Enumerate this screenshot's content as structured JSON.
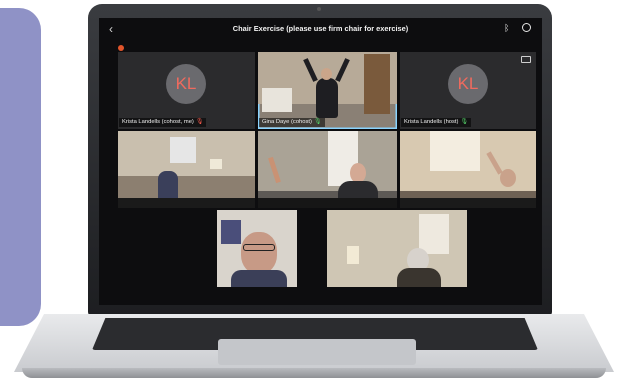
{
  "meeting": {
    "title": "Chair Exercise (please use firm chair for exercise)",
    "back_icon": "chevron-left-icon",
    "bluetooth_icon": "bluetooth-icon",
    "power_icon": "power-icon"
  },
  "tiles": [
    {
      "name": "Krista Landells (cohost, me)",
      "initials": "KL",
      "muted": true
    },
    {
      "name": "Gina Daye (cohost)",
      "muted": false,
      "active": true
    },
    {
      "name": "Krista Landells (host)",
      "initials": "KL",
      "muted": false
    }
  ],
  "colors": {
    "side_panel": "#8f92c6",
    "avatar_initials": "#f06a5e",
    "active_border": "#8ad4ff",
    "mic_muted": "#ff5b4d",
    "mic_on": "#55d46a"
  }
}
